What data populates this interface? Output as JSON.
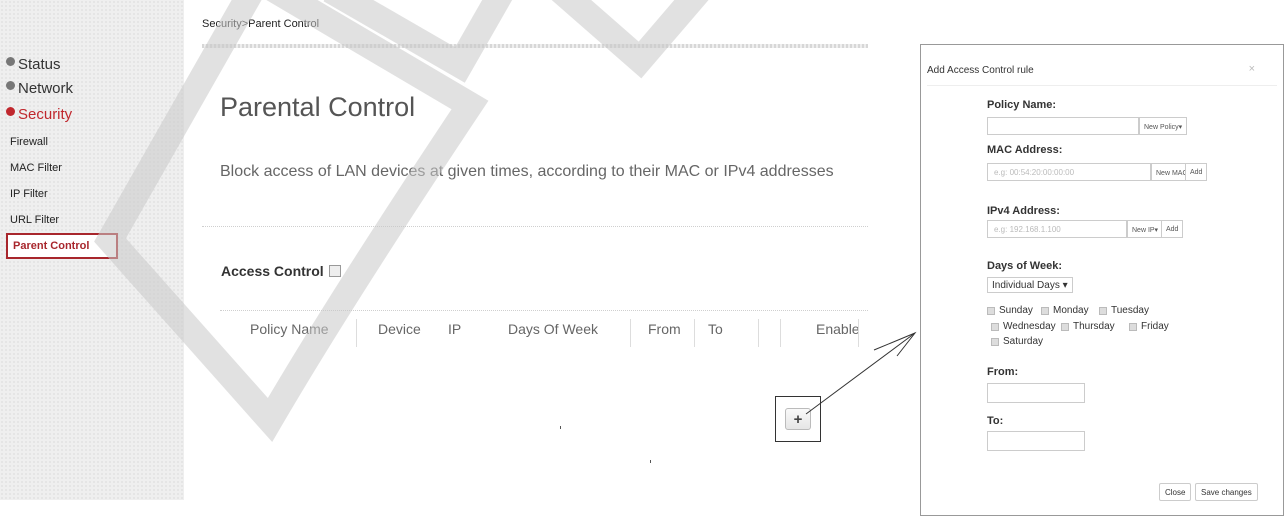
{
  "breadcrumb": "Security>Parent Control",
  "sidebar": {
    "top_items": [
      {
        "label": "Status",
        "active": false
      },
      {
        "label": "Network",
        "active": false
      },
      {
        "label": "Security",
        "active": true
      }
    ],
    "sub_items": [
      "Firewall",
      "MAC Filter",
      "IP Filter",
      "URL Filter"
    ],
    "selected_item": "Parent Control"
  },
  "main": {
    "title": "Parental Control",
    "description": "Block access of LAN devices at given times, according to their MAC or IPv4 addresses",
    "access_control_label": "Access Control",
    "table_headers": [
      "Policy Name",
      "Device",
      "IP",
      "Days Of Week",
      "From",
      "To",
      "",
      "Enable"
    ],
    "add_button_icon": "plus-icon"
  },
  "watermark": "DRAFT",
  "dialog": {
    "title": "Add Access Control rule",
    "close_symbol": "×",
    "policy_name_label": "Policy Name:",
    "policy_name_value": "",
    "new_policy_button": "New Policy▾",
    "mac_label": "MAC Address:",
    "mac_placeholder": "e.g: 00:54:20:00:00:00",
    "new_mac_button": "New MAC▾",
    "mac_add_button": "Add",
    "ipv4_label": "IPv4 Address:",
    "ipv4_placeholder": "e.g: 192.168.1.100",
    "new_ip_button": "New IP▾",
    "ip_add_button": "Add",
    "days_label": "Days of Week:",
    "days_select": "Individual Days ▾",
    "days": [
      "Sunday",
      "Monday",
      "Tuesday",
      "Wednesday",
      "Thursday",
      "Friday",
      "Saturday"
    ],
    "from_label": "From:",
    "to_label": "To:",
    "close_button": "Close",
    "save_button": "Save changes"
  },
  "colors": {
    "accent": "#c0272d",
    "sidebar_bg": "#efefef"
  }
}
